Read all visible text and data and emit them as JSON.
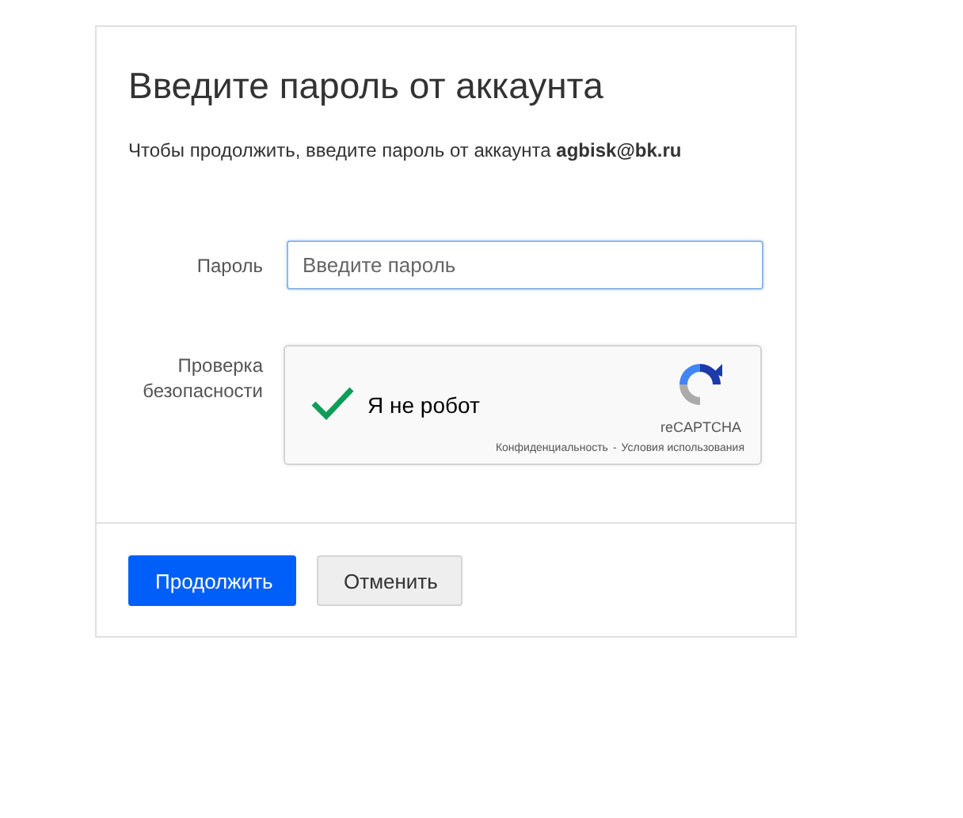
{
  "title": "Введите пароль от аккаунта",
  "subtitle": "Чтобы продолжить, введите пароль от аккаунта **agbisk@bk.ru**",
  "password": {
    "label": "Пароль",
    "placeholder": "Введите пароль"
  },
  "captcha": {
    "label": "Проверка безопасности",
    "checked": true,
    "text": "Я не робот",
    "brand": "reCAPTCHA",
    "links": [
      "Конфиденциальность",
      "Условия использования"
    ],
    "separator": "-"
  },
  "buttons": [
    {
      "label": "Продолжить",
      "kind": "primary"
    },
    {
      "label": "Отменить",
      "kind": "secondary"
    }
  ]
}
